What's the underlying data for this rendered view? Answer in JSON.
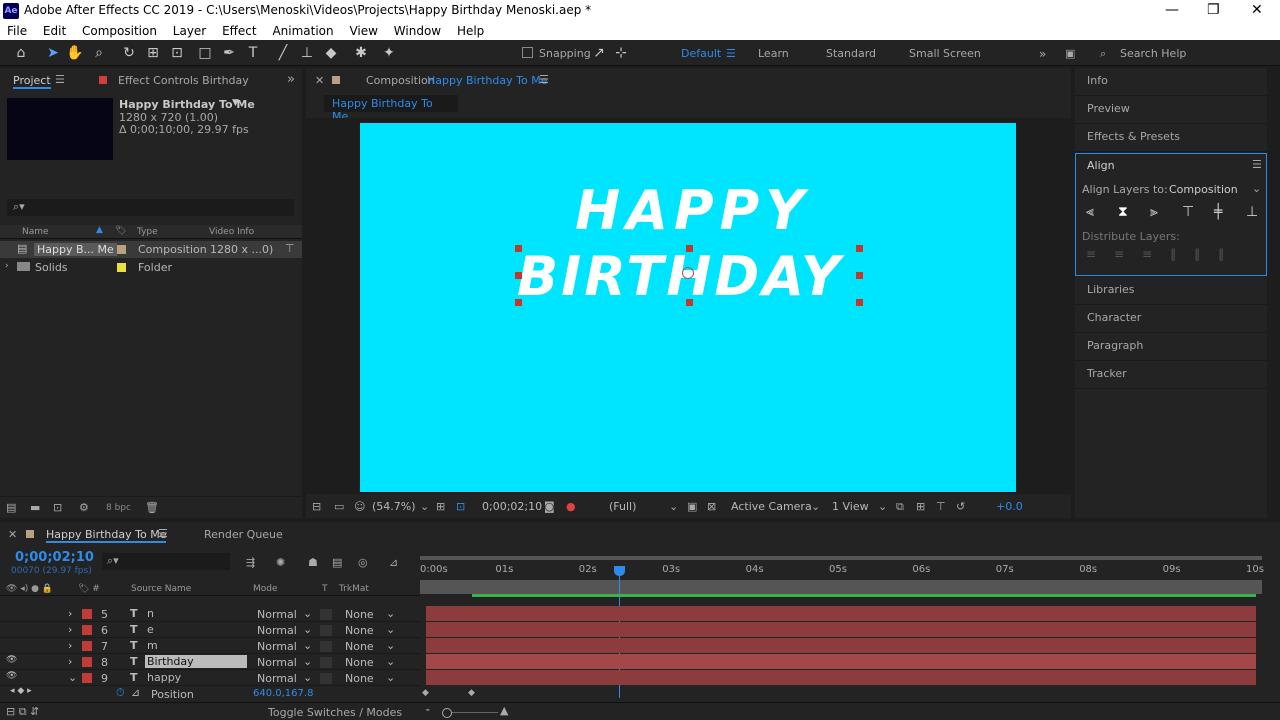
{
  "window": {
    "title": "Adobe After Effects CC 2019 - C:\\Users\\Menoski\\Videos\\Projects\\Happy Birthday Menoski.aep *",
    "app_icon": "Ae"
  },
  "menu": [
    "File",
    "Edit",
    "Composition",
    "Layer",
    "Effect",
    "Animation",
    "View",
    "Window",
    "Help"
  ],
  "toolbar": {
    "snapping": "Snapping",
    "workspaces": [
      "Default",
      "Learn",
      "Standard",
      "Small Screen"
    ],
    "search_placeholder": "Search Help"
  },
  "project": {
    "tab": "Project",
    "effect_tab": "Effect Controls Birthday",
    "comp_name": "Happy Birthday To Me",
    "comp_size": "1280 x 720 (1.00)",
    "comp_duration": "Δ 0;00;10;00, 29.97 fps",
    "columns": [
      "Name",
      "Type",
      "Video Info"
    ],
    "items": [
      {
        "name": "Happy B... Me",
        "type": "Composition",
        "info": "1280 x ...0)"
      },
      {
        "name": "Solids",
        "type": "Folder",
        "info": ""
      }
    ],
    "bpc": "8 bpc"
  },
  "composition": {
    "tab_prefix": "Composition",
    "tab_name": "Happy Birthday To Me",
    "subtab": "Happy Birthday To Me",
    "text_line1": "HAPPY",
    "text_line2": "BIRTHDAY",
    "bg_color": "#00e5ff",
    "zoom": "(54.7%)",
    "timecode": "0;00;02;10",
    "resolution": "(Full)",
    "camera": "Active Camera",
    "view": "1 View",
    "exposure": "+0.0"
  },
  "right_panels": {
    "top": [
      "Info",
      "Preview",
      "Effects & Presets"
    ],
    "align": {
      "title": "Align",
      "align_to_label": "Align Layers to:",
      "align_to_value": "Composition",
      "distribute_label": "Distribute Layers:"
    },
    "bottom": [
      "Libraries",
      "Character",
      "Paragraph",
      "Tracker"
    ]
  },
  "timeline": {
    "tab": "Happy Birthday To Me",
    "render_queue": "Render Queue",
    "timecode": "0;00;02;10",
    "frame_info": "00070 (29.97 fps)",
    "columns": {
      "source": "Source Name",
      "mode": "Mode",
      "t": "T",
      "trkmat": "TrkMat"
    },
    "ruler": [
      "0:00s",
      "01s",
      "02s",
      "03s",
      "04s",
      "05s",
      "06s",
      "07s",
      "08s",
      "09s",
      "10s"
    ],
    "layers": [
      {
        "num": "5",
        "name": "n",
        "mode": "Normal",
        "trk": "None"
      },
      {
        "num": "6",
        "name": "e",
        "mode": "Normal",
        "trk": "None"
      },
      {
        "num": "7",
        "name": "m",
        "mode": "Normal",
        "trk": "None"
      },
      {
        "num": "8",
        "name": "Birthday",
        "mode": "Normal",
        "trk": "None"
      },
      {
        "num": "9",
        "name": "happy",
        "mode": "Normal",
        "trk": "None"
      }
    ],
    "property": {
      "name": "Position",
      "value": "640.0,167.8"
    },
    "toggle_label": "Toggle Switches / Modes"
  },
  "colors": {
    "accent": "#2d8ceb",
    "label_red": "#c23b3b",
    "label_yellow": "#e8e040",
    "layer_bar": "#8c3c3c"
  }
}
